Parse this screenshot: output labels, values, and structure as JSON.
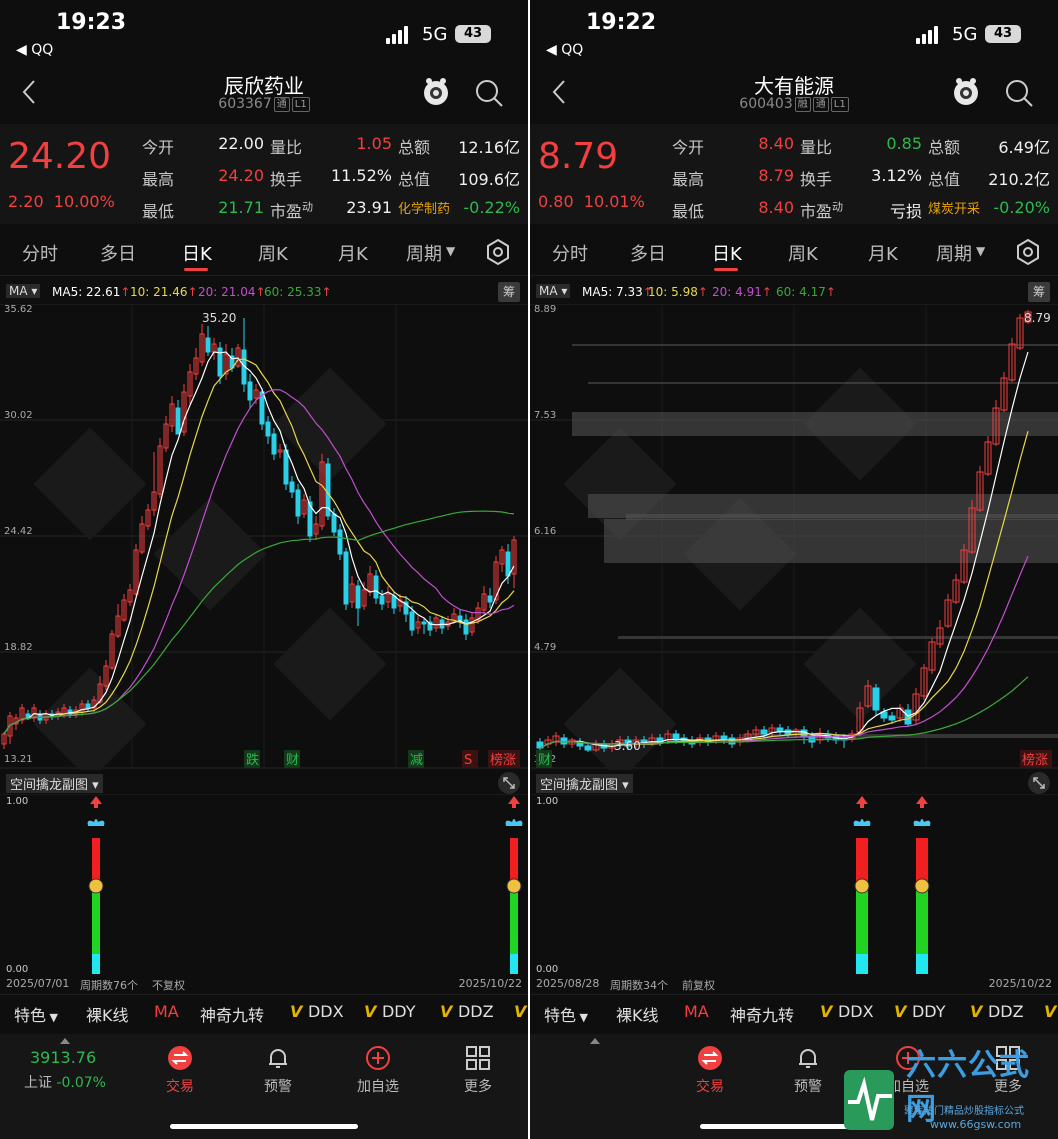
{
  "screens": [
    {
      "status": {
        "time": "19:23",
        "back_app": "◀ QQ",
        "network": "5G",
        "battery": "43"
      },
      "nav": {
        "title": "辰欣药业",
        "code": "603367",
        "tags": [
          "通",
          "L1"
        ]
      },
      "quote": {
        "price": "24.20",
        "change": "2.20",
        "change_pct": "10.00%",
        "rows": [
          {
            "l1": "今开",
            "v1": "22.00",
            "c1": "white",
            "l2": "量比",
            "v2": "1.05",
            "c2": "red",
            "l3": "总额",
            "v3": "12.16亿",
            "c3": "white"
          },
          {
            "l1": "最高",
            "v1": "24.20",
            "c1": "red",
            "l2": "换手",
            "v2": "11.52%",
            "c2": "white",
            "l3": "总值",
            "v3": "109.6亿",
            "c3": "white"
          },
          {
            "l1": "最低",
            "v1": "21.71",
            "c1": "green",
            "l2": "市盈",
            "l2sup": "动",
            "v2": "23.91",
            "c2": "white",
            "l3": "化学制药",
            "v3": "-0.22%",
            "c3": "green",
            "l3orange": true
          }
        ]
      },
      "tabs": [
        "分时",
        "多日",
        "日K",
        "周K",
        "月K",
        "周期"
      ],
      "ma": {
        "select": "MA",
        "ma5": "MA5: 22.61",
        "ma10": "10: 21.46",
        "ma20": "20: 21.04",
        "ma60": "60: 25.33",
        "chou": "筹"
      },
      "chart": {
        "ylabels": [
          "35.62",
          "30.02",
          "24.42",
          "18.82",
          "13.21"
        ],
        "high_label": "35.20",
        "event_tags": [
          {
            "t": "跌",
            "c": "green"
          },
          {
            "t": "财",
            "c": "green"
          },
          {
            "t": "减",
            "c": "green"
          },
          {
            "t": "S",
            "c": "red"
          },
          {
            "t": "榜涨",
            "c": "red"
          }
        ]
      },
      "sub": {
        "title": "空间擒龙副图",
        "ymax": "1.00",
        "ymin": "0.00"
      },
      "footer": {
        "start_date": "2025/07/01",
        "period": "周期数76个",
        "adjust": "不复权",
        "end_date": "2025/10/22"
      },
      "indicators": [
        "特色",
        "裸K线",
        "MA",
        "神奇九转",
        "DDX",
        "DDY",
        "DDZ"
      ],
      "bottom": {
        "index_value": "3913.76",
        "index_name": "上证",
        "index_change": "-0.07%",
        "items": [
          "交易",
          "预警",
          "加自选",
          "更多"
        ]
      }
    },
    {
      "status": {
        "time": "19:22",
        "back_app": "◀ QQ",
        "network": "5G",
        "battery": "43"
      },
      "nav": {
        "title": "大有能源",
        "code": "600403",
        "tags": [
          "融",
          "通",
          "L1"
        ]
      },
      "quote": {
        "price": "8.79",
        "change": "0.80",
        "change_pct": "10.01%",
        "rows": [
          {
            "l1": "今开",
            "v1": "8.40",
            "c1": "red",
            "l2": "量比",
            "v2": "0.85",
            "c2": "green",
            "l3": "总额",
            "v3": "6.49亿",
            "c3": "white"
          },
          {
            "l1": "最高",
            "v1": "8.79",
            "c1": "red",
            "l2": "换手",
            "v2": "3.12%",
            "c2": "white",
            "l3": "总值",
            "v3": "210.2亿",
            "c3": "white"
          },
          {
            "l1": "最低",
            "v1": "8.40",
            "c1": "red",
            "l2": "市盈",
            "l2sup": "动",
            "v2": "亏损",
            "c2": "white",
            "l3": "煤炭开采",
            "v3": "-0.20%",
            "c3": "green",
            "l3orange": true
          }
        ]
      },
      "tabs": [
        "分时",
        "多日",
        "日K",
        "周K",
        "月K",
        "周期"
      ],
      "ma": {
        "select": "MA",
        "ma5": "MA5: 7.33",
        "ma10": "10: 5.98",
        "ma20": "20: 4.91",
        "ma60": "60: 4.17",
        "chou": "筹"
      },
      "chart": {
        "ylabels": [
          "8.89",
          "7.53",
          "6.16",
          "4.79",
          "3.42"
        ],
        "high_label": "8.79",
        "low_label": "3.60",
        "event_tags": [
          {
            "t": "财",
            "c": "green"
          },
          {
            "t": "榜涨",
            "c": "red"
          }
        ]
      },
      "sub": {
        "title": "空间擒龙副图",
        "ymax": "1.00",
        "ymin": "0.00"
      },
      "footer": {
        "start_date": "2025/08/28",
        "period": "周期数34个",
        "adjust": "前复权",
        "end_date": "2025/10/22"
      },
      "indicators": [
        "特色",
        "裸K线",
        "MA",
        "神奇九转",
        "DDX",
        "DDY",
        "DDZ"
      ],
      "bottom": {
        "items": [
          "交易",
          "预警",
          "加自选",
          "更多"
        ]
      }
    }
  ],
  "watermark": {
    "brand": "六六公式网",
    "slogan": "聚焦热门精品炒股指标公式",
    "url": "www.66gsw.com"
  },
  "colors": {
    "up": "#f23f3f",
    "down": "#2db84e",
    "ma5": "#ffffff",
    "ma10": "#e6d84a",
    "ma20": "#c24fd0",
    "ma60": "#3aa83a"
  }
}
